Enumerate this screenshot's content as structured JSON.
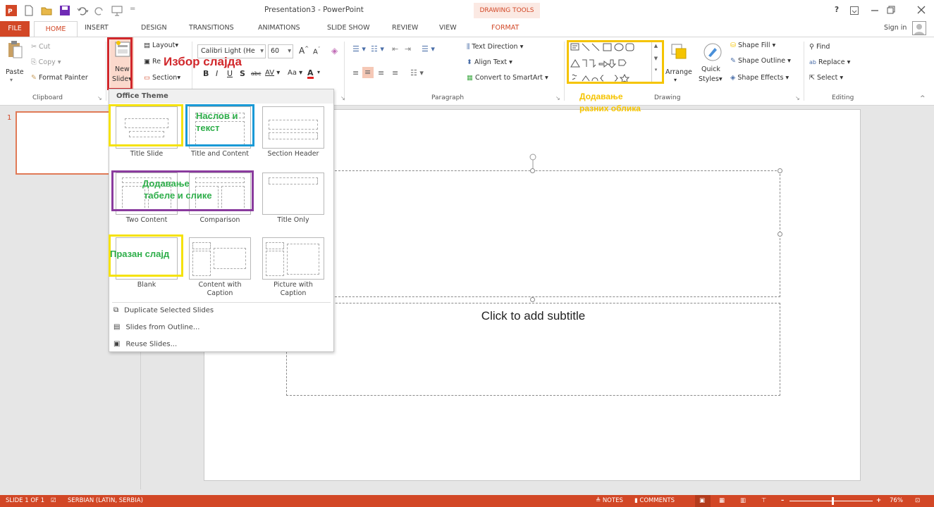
{
  "titlebar": {
    "title": "Presentation3 - PowerPoint",
    "context_group": "DRAWING TOOLS",
    "help": "?",
    "sign_in": "Sign in"
  },
  "tabs": [
    "FILE",
    "HOME",
    "INSERT",
    "DESIGN",
    "TRANSITIONS",
    "ANIMATIONS",
    "SLIDE SHOW",
    "REVIEW",
    "VIEW",
    "FORMAT"
  ],
  "clipboard": {
    "paste": "Paste",
    "cut": "Cut",
    "copy": "Copy",
    "format_painter": "Format Painter",
    "group": "Clipboard"
  },
  "slides": {
    "new_slide": "New",
    "new_slide_2": "Slide",
    "layout": "Layout",
    "reset": "Re",
    "section": "Section"
  },
  "font": {
    "name": "Calibri Light (He",
    "size": "60",
    "case": "Aa"
  },
  "paragraph": {
    "text_direction": "Text Direction",
    "align_text": "Align Text",
    "convert_smartart": "Convert to SmartArt",
    "group": "Paragraph"
  },
  "drawing": {
    "arrange": "Arrange",
    "quick": "Quick",
    "styles": "Styles",
    "shape_fill": "Shape Fill",
    "shape_outline": "Shape Outline",
    "shape_effects": "Shape Effects",
    "group": "Drawing"
  },
  "editing": {
    "find": "Find",
    "replace": "Replace",
    "select": "Select",
    "group": "Editing"
  },
  "gallery": {
    "title": "Office Theme",
    "layouts": [
      {
        "name": "Title Slide"
      },
      {
        "name": "Title and Content"
      },
      {
        "name": "Section Header"
      },
      {
        "name": "Two Content"
      },
      {
        "name": "Comparison"
      },
      {
        "name": "Title Only"
      },
      {
        "name": "Blank"
      },
      {
        "name": "Content with Caption"
      },
      {
        "name": "Picture with Caption"
      }
    ],
    "items": [
      "Duplicate Selected Slides",
      "Slides from Outline...",
      "Reuse Slides..."
    ]
  },
  "annotations": {
    "choose_slide": "Избор слајда",
    "title_text_1": "Наслов и",
    "title_text_2": "текст",
    "table_image_1": "Додавање",
    "table_image_2": "табеле и слике",
    "blank_slide": "Празан слајд",
    "shapes_1": "Додавање",
    "shapes_2": "разних облика"
  },
  "slide_pane": {
    "number": "1"
  },
  "slide": {
    "subtitle_placeholder": "Click to add subtitle"
  },
  "status": {
    "slide_count": "SLIDE 1 OF 1",
    "language": "SERBIAN (LATIN, SERBIA)",
    "notes": "NOTES",
    "comments": "COMMENTS",
    "zoom": "76%"
  },
  "colors": {
    "accent": "#d24726",
    "annotation_red": "#d1272b",
    "annotation_yellow": "#f5e20a",
    "annotation_cyan": "#1a9ad6",
    "annotation_purple": "#8a3b9e",
    "annotation_gold": "#f5c400",
    "annotation_green_text": "#2eae4a"
  }
}
